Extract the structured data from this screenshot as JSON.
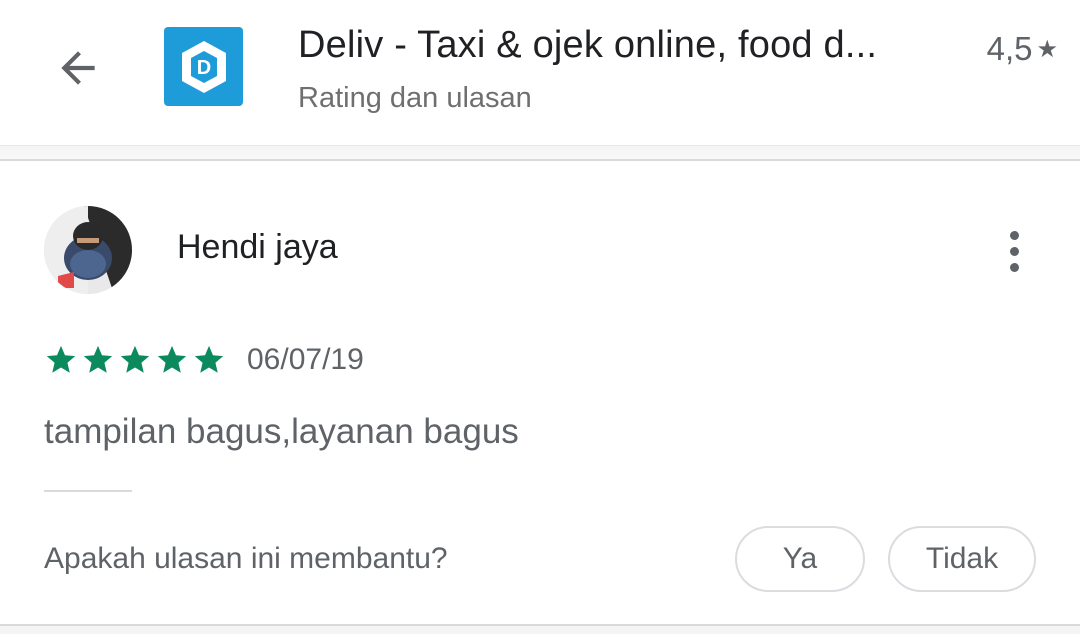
{
  "header": {
    "app_name": "Deliv - Taxi & ojek online, food d...",
    "subtitle": "Rating dan ulasan",
    "rating": "4,5",
    "rating_icon": "star-icon",
    "back_icon": "arrow-left-icon",
    "app_icon_letter": "D",
    "app_icon_color": "#1e9bd9"
  },
  "review": {
    "reviewer_name": "Hendi jaya",
    "star_rating": 5,
    "star_color": "#0b8a5e",
    "date": "06/07/19",
    "text": "tampilan bagus,layanan bagus",
    "menu_icon": "more-vertical-icon"
  },
  "helpful": {
    "question": "Apakah ulasan ini membantu?",
    "yes_label": "Ya",
    "no_label": "Tidak"
  }
}
